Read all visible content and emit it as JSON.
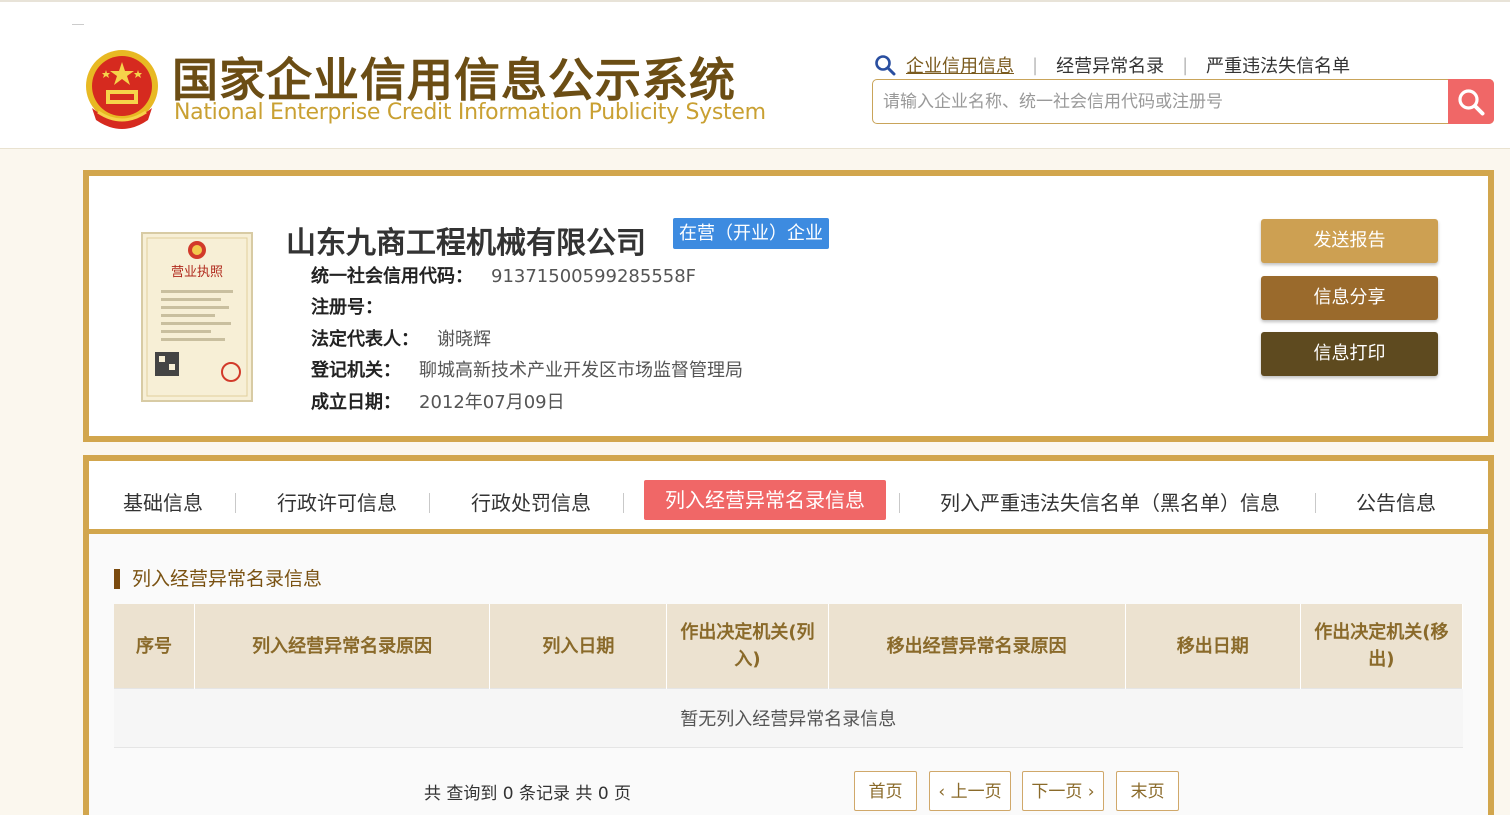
{
  "header": {
    "title_cn": "国家企业信用信息公示系统",
    "title_en": "National Enterprise Credit Information Publicity System",
    "links": [
      "企业信用信息",
      "经营异常名录",
      "严重违法失信名单"
    ],
    "search_placeholder": "请输入企业名称、统一社会信用代码或注册号"
  },
  "company": {
    "name": "山东九商工程机械有限公司",
    "status": "在营（开业）企业",
    "fields": [
      {
        "label": "统一社会信用代码：",
        "value": "91371500599285558F"
      },
      {
        "label": "注册号：",
        "value": ""
      },
      {
        "label": "法定代表人：",
        "value": "谢晓辉"
      },
      {
        "label": "登记机关：",
        "value": "聊城高新技术产业开发区市场监督管理局"
      },
      {
        "label": "成立日期：",
        "value": "2012年07月09日"
      }
    ],
    "license_label": "营业执照",
    "actions": [
      "发送报告",
      "信息分享",
      "信息打印"
    ]
  },
  "tabs": [
    "基础信息",
    "行政许可信息",
    "行政处罚信息",
    "列入经营异常名录信息",
    "列入严重违法失信名单（黑名单）信息",
    "公告信息"
  ],
  "section": {
    "title": "列入经营异常名录信息",
    "columns": [
      "序号",
      "列入经营异常名录原因",
      "列入日期",
      "作出决定机关(列入)",
      "移出经营异常名录原因",
      "移出日期",
      "作出决定机关(移出)"
    ],
    "empty_text": "暂无列入经营异常名录信息"
  },
  "pager": {
    "summary": "共 查询到 0 条记录 共 0 页",
    "first": "首页",
    "prev": "上一页",
    "next": "下一页",
    "last": "末页"
  },
  "colors": {
    "gold": "#d2a64d",
    "accent_red": "#f06767",
    "status_blue": "#3d8be0",
    "btn1": "#cda052",
    "btn2": "#9a6a2c",
    "btn3": "#5e4a1f"
  }
}
